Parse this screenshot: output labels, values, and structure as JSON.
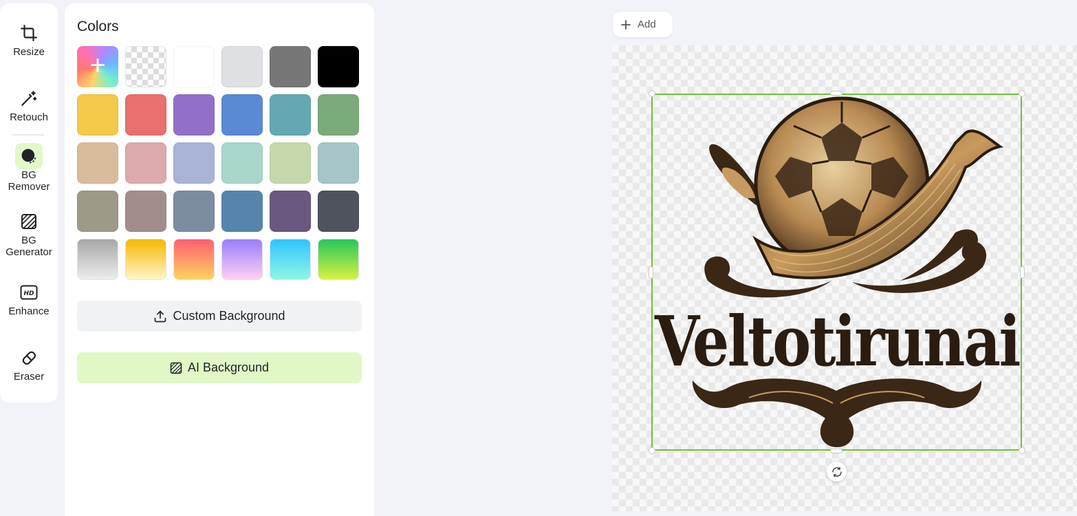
{
  "sidebar": {
    "tools": [
      {
        "label": "Resize",
        "icon": "crop-icon",
        "active": false
      },
      {
        "label": "Retouch",
        "icon": "magic-wand-icon",
        "active": false
      },
      {
        "label": "BG Remover",
        "icon": "bg-remover-icon",
        "active": true
      },
      {
        "label": "BG Generator",
        "icon": "bg-generator-icon",
        "active": false
      },
      {
        "label": "Enhance",
        "icon": "hd-icon",
        "active": false
      },
      {
        "label": "Eraser",
        "icon": "eraser-icon",
        "active": false
      }
    ]
  },
  "panel": {
    "title": "Colors",
    "swatches": [
      [
        "custom",
        "transparent",
        "#ffffff",
        "#dfe0e3",
        "#777777",
        "#000000"
      ],
      [
        "#f3c94a",
        "#e96f70",
        "#9370c7",
        "#5a89d6",
        "#64a8b1",
        "#7baa7b"
      ],
      [
        "#d9bb9d",
        "#dcaaad",
        "#a9b3d5",
        "#a8d6cb",
        "#c4d8ac",
        "#a5c5c8"
      ],
      [
        "#9e9a88",
        "#a38d8c",
        "#7c8da2",
        "#5784ad",
        "#6b587e",
        "#4f545c"
      ],
      [
        "linear-gradient(180deg,#a7a7a7,#ededed)",
        "linear-gradient(180deg,#f5b800,#fff6c9)",
        "linear-gradient(180deg,#ff5f70,#ffd25e)",
        "linear-gradient(180deg,#9a7dff,#ffd1f0)",
        "linear-gradient(180deg,#2fc4ff,#8ff5e6)",
        "linear-gradient(180deg,#25c65a,#d9f243)"
      ]
    ],
    "custom_background_label": "Custom Background",
    "ai_background_label": "AI Background"
  },
  "canvas": {
    "add_label": "Add",
    "logo_text": "Veltotirunai"
  },
  "colors": {
    "accent_green": "#6dc236",
    "active_tool_bg": "#e3f7c9",
    "ai_button_bg": "#e2f7c6"
  }
}
